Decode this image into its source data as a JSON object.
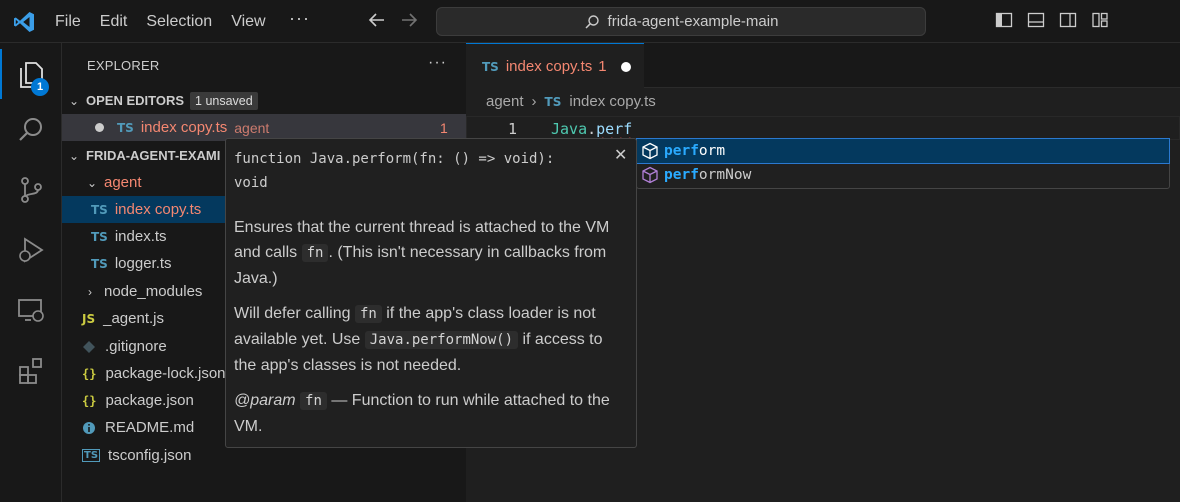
{
  "titlebar": {
    "menu": [
      "File",
      "Edit",
      "Selection",
      "View"
    ],
    "more": "···",
    "search_text": "frida-agent-example-main"
  },
  "activity": {
    "explorer_badge": "1"
  },
  "sidebar": {
    "title": "EXPLORER",
    "more": "···",
    "open_editors": {
      "label": "OPEN EDITORS",
      "unsaved_badge": "1 unsaved",
      "file": {
        "icon": "TS",
        "name": "index copy.ts",
        "folder": "agent",
        "problems": "1"
      }
    },
    "project": {
      "label": "FRIDA-AGENT-EXAMI",
      "folder_agent": "agent",
      "agent_files": [
        {
          "icon": "TS",
          "name": "index copy.ts"
        },
        {
          "icon": "TS",
          "name": "index.ts"
        },
        {
          "icon": "TS",
          "name": "logger.ts"
        }
      ],
      "node_modules": "node_modules",
      "files": [
        {
          "icon": "JS",
          "name": "_agent.js"
        },
        {
          "icon": "git",
          "name": ".gitignore"
        },
        {
          "icon": "{}",
          "name": "package-lock.json"
        },
        {
          "icon": "{}",
          "name": "package.json"
        },
        {
          "icon": "info",
          "name": "README.md"
        },
        {
          "icon": "TS",
          "name": "tsconfig.json"
        }
      ]
    }
  },
  "editor": {
    "tab": {
      "icon": "TS",
      "name": "index copy.ts",
      "problems": "1"
    },
    "breadcrumb": [
      "agent",
      "index copy.ts"
    ],
    "breadcrumb_icon": "TS",
    "line_number": "1",
    "code_var": "Java",
    "code_dot": ".",
    "code_prop": "perf"
  },
  "suggest": [
    {
      "match": "perf",
      "rest": "orm"
    },
    {
      "match": "perf",
      "rest": "ormNow"
    }
  ],
  "doc": {
    "signature": "function Java.perform(fn: () => void): void",
    "close": "✕",
    "p1_a": "Ensures that the current thread is attached to the VM and calls ",
    "p1_code": "fn",
    "p1_b": ". (This isn't necessary in callbacks from Java.)",
    "p2_a": "Will defer calling ",
    "p2_code": "fn",
    "p2_b": " if the app's class loader is not available yet. Use ",
    "p2_code2": "Java.performNow()",
    "p2_c": " if access to the app's classes is not needed.",
    "p3_tag": "@param",
    "p3_code": "fn",
    "p3_text": " — Function to run while attached to the VM."
  },
  "colors": {
    "accent": "#0078d4",
    "modified": "#f48771",
    "ts_icon": "#519aba"
  }
}
